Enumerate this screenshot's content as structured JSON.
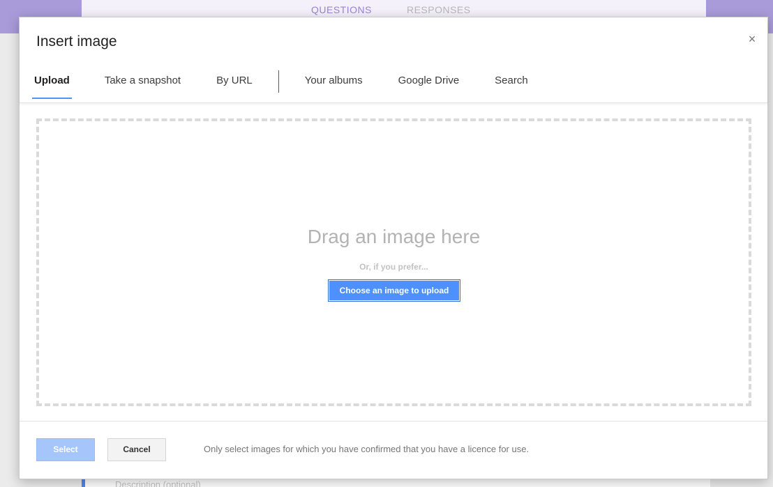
{
  "background": {
    "tabs": {
      "questions": "QUESTIONS",
      "responses": "RESPONSES"
    },
    "description_placeholder": "Description (optional)",
    "colors": {
      "header": "#a99bd9",
      "accent": "#9a83d6"
    }
  },
  "dialog": {
    "title": "Insert image",
    "close_icon": "close-icon",
    "close_glyph": "×",
    "tabs": [
      {
        "label": "Upload",
        "active": true
      },
      {
        "label": "Take a snapshot",
        "active": false
      },
      {
        "label": "By URL",
        "active": false
      },
      {
        "label": "Your albums",
        "active": false
      },
      {
        "label": "Google Drive",
        "active": false
      },
      {
        "label": "Search",
        "active": false
      }
    ],
    "dropzone": {
      "title": "Drag an image here",
      "subtitle": "Or, if you prefer...",
      "button_label": "Choose an image to upload"
    },
    "footer": {
      "select_label": "Select",
      "cancel_label": "Cancel",
      "note": "Only select images for which you have confirmed that you have a licence for use."
    },
    "colors": {
      "primary": "#4d90fe",
      "primary_disabled": "#a6c5fa",
      "dashed_border": "#dadada"
    }
  }
}
